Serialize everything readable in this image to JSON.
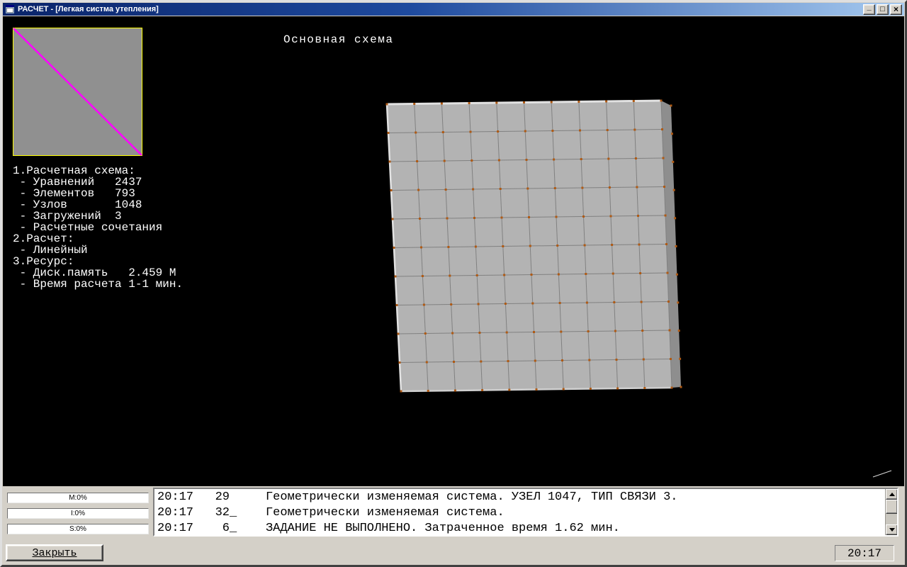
{
  "window": {
    "title": "РАСЧЕТ - [Легкая систма утепления]",
    "buttons": [
      {
        "name": "minimize",
        "glyph": "_"
      },
      {
        "name": "restore",
        "glyph": "□"
      },
      {
        "name": "close",
        "glyph": "×"
      }
    ]
  },
  "canvas": {
    "heading": "Основная схема",
    "info_lines": [
      "1.Расчетная схема:",
      " - Уравнений   2437",
      " - Элементов   793",
      " - Узлов       1048",
      " - Загружений  3",
      " - Расчетные сочетания",
      "2.Расчет:",
      " - Линейный",
      "3.Ресурс:",
      " - Диск.память   2.459 М",
      " - Время расчета 1-1 мин."
    ]
  },
  "model": {
    "divisions": 10,
    "face_color": "#b3b3b3",
    "side_color": "#8e8e8e",
    "grid_color": "#818181",
    "node_color": "#b05a14",
    "edge_highlight": "#e2e2e2",
    "bottom_edge_color": "#cfcfcf",
    "thumbnail": {
      "fill": "#909090",
      "border_color": "#ffff00",
      "line_color": "#ff00ff"
    }
  },
  "status_panel": {
    "progress_bars": [
      {
        "id": "M",
        "label": "M:0%",
        "value": 0
      },
      {
        "id": "I",
        "label": "I:0%",
        "value": 0
      },
      {
        "id": "S",
        "label": "S:0%",
        "value": 0
      }
    ],
    "log_rows": [
      {
        "time": "20:17",
        "num": "29",
        "message": "Геометрически изменяемая система. УЗЕЛ 1047, ТИП СВЯЗИ 3."
      },
      {
        "time": "20:17",
        "num": "32_",
        "message": "Геометрически изменяемая система."
      },
      {
        "time": "20:17",
        "num": " 6_",
        "message": "ЗАДАНИЕ НЕ ВЫПОЛНЕНО. Затраченное время 1.62 мин."
      }
    ]
  },
  "footer": {
    "close_label": "Закрыть",
    "clock": "20:17"
  }
}
